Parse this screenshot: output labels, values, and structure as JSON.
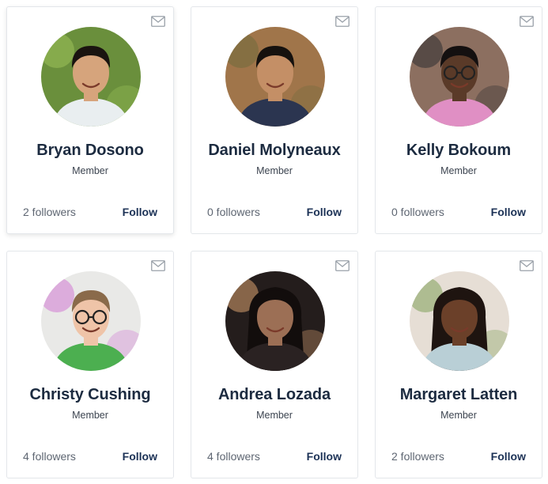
{
  "members": [
    {
      "name": "Bryan Dosono",
      "role": "Member",
      "followers": "2 followers",
      "follow_label": "Follow",
      "photo": {
        "bg": "#6a8f3c",
        "skin": "#d6a47c",
        "hair": "#1a1410",
        "shirt": "#e9eef0",
        "long_hair": false,
        "glasses": false,
        "accent": "#9cc35a"
      }
    },
    {
      "name": "Daniel Molyneaux",
      "role": "Member",
      "followers": "0 followers",
      "follow_label": "Follow",
      "photo": {
        "bg": "#a0754a",
        "skin": "#c48f66",
        "hair": "#15110e",
        "shirt": "#2b3550",
        "long_hair": false,
        "glasses": false,
        "accent": "#6f6a3c"
      }
    },
    {
      "name": "Kelly Bokoum",
      "role": "Member",
      "followers": "0 followers",
      "follow_label": "Follow",
      "photo": {
        "bg": "#8c6f60",
        "skin": "#5a3a28",
        "hair": "#141010",
        "shirt": "#e08fc4",
        "long_hair": false,
        "glasses": true,
        "accent": "#2e2e32"
      }
    },
    {
      "name": "Christy Cushing",
      "role": "Member",
      "followers": "4 followers",
      "follow_label": "Follow",
      "photo": {
        "bg": "#e9e9e7",
        "skin": "#efc4a8",
        "hair": "#8a6a4a",
        "shirt": "#4caf50",
        "long_hair": false,
        "glasses": true,
        "accent": "#d17ad4"
      }
    },
    {
      "name": "Andrea Lozada",
      "role": "Member",
      "followers": "4 followers",
      "follow_label": "Follow",
      "photo": {
        "bg": "#241d1c",
        "skin": "#9c6f55",
        "hair": "#120d0c",
        "shirt": "#2a2222",
        "long_hair": true,
        "glasses": false,
        "accent": "#d8a070"
      }
    },
    {
      "name": "Margaret Latten",
      "role": "Member",
      "followers": "2 followers",
      "follow_label": "Follow",
      "photo": {
        "bg": "#e6ded5",
        "skin": "#6b4029",
        "hair": "#1e1410",
        "shirt": "#b9cfd6",
        "long_hair": true,
        "glasses": false,
        "accent": "#7fa05a"
      }
    }
  ],
  "icons": {
    "message": "envelope-icon"
  },
  "colors": {
    "name": "#1c2b40",
    "follow": "#1c3256",
    "muted": "#5e6672",
    "border": "#e3e6ea"
  }
}
